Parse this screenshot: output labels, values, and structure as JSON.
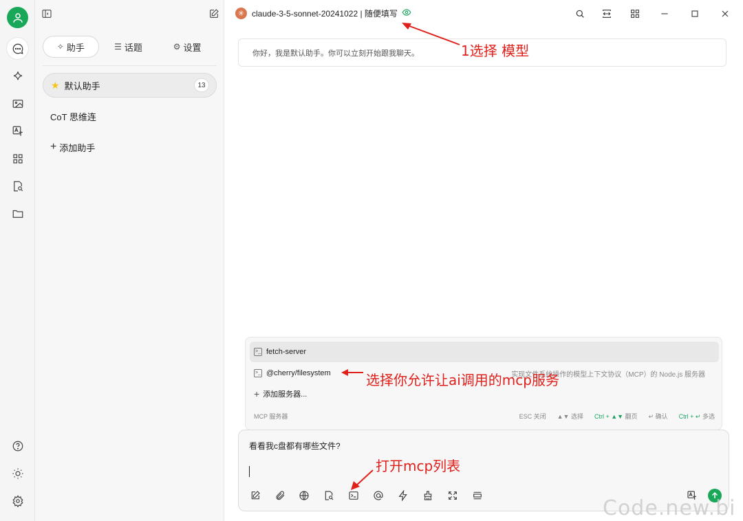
{
  "rail": {
    "items": [
      "chat",
      "assistant",
      "image",
      "translate",
      "apps",
      "knowledge",
      "files"
    ],
    "bottom": [
      "help",
      "theme",
      "settings"
    ]
  },
  "panel": {
    "tabs": [
      {
        "label": "助手",
        "icon": "sparkle-icon"
      },
      {
        "label": "话题",
        "icon": "list-icon"
      },
      {
        "label": "设置",
        "icon": "gear-icon"
      }
    ],
    "assistants": [
      {
        "label": "默认助手",
        "badge": "13"
      },
      {
        "label": "CoT 思维连"
      }
    ],
    "add_label": "添加助手"
  },
  "topbar": {
    "model_name": "claude-3-5-sonnet-20241022 | 随便填写"
  },
  "chat": {
    "welcome": "你好，我是默认助手。你可以立刻开始跟我聊天。"
  },
  "mcp": {
    "items": [
      {
        "label": "fetch-server",
        "desc": ""
      },
      {
        "label": "@cherry/filesystem",
        "desc": "实现文件系统操作的模型上下文协议（MCP）的 Node.js 服务器"
      }
    ],
    "add_label": "添加服务器...",
    "footer_title": "MCP 服务器",
    "footer_keys": [
      {
        "key": "ESC",
        "label": "关闭"
      },
      {
        "key": "▲▼",
        "label": "选择"
      },
      {
        "key": "Ctrl + ▲▼",
        "label": "翻页"
      },
      {
        "key": "↵",
        "label": "确认"
      },
      {
        "key": "Ctrl + ↵",
        "label": "多选"
      }
    ]
  },
  "input": {
    "text": "看看我c盘都有哪些文件?"
  },
  "annotations": {
    "select_model": "1选择 模型",
    "select_mcp": "选择你允许让ai调用的mcp服务",
    "open_mcp": "打开mcp列表"
  },
  "watermark": "Code.new.bi",
  "colors": {
    "accent": "#19a75a",
    "annotation": "#e0201b"
  }
}
